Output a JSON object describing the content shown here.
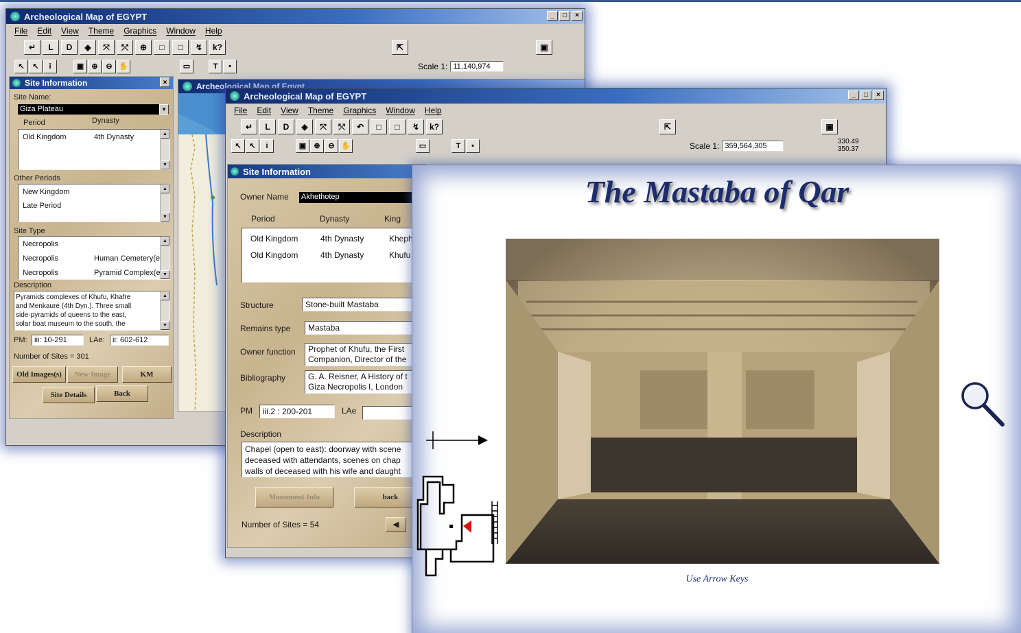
{
  "screen": {
    "accent": "#3a6ec0",
    "panel_color": "#d2c09c"
  },
  "back_window": {
    "title": "Archeological Map of EGYPT",
    "controls": [
      "_",
      "□",
      "×"
    ],
    "menu": [
      "File",
      "Edit",
      "View",
      "Theme",
      "Graphics",
      "Window",
      "Help"
    ],
    "tools_row1": [
      "↵",
      "L",
      "D",
      "◈",
      "⤧",
      "⤲",
      "⊕",
      "□",
      "□",
      "↯",
      "k?"
    ],
    "tools_row2": [
      "↖",
      "↖",
      "i",
      "▣",
      "⊕",
      "⊖",
      "✋",
      "▭",
      "T",
      "•"
    ],
    "scale_label": "Scale 1:",
    "scale_value": "11,140,974",
    "inner_title": "Archeological Map of Egypt",
    "site_info": {
      "title": "Site Information",
      "site_name_label": "Site Name:",
      "site_name_value": "Giza Plateau",
      "col_period": "Period",
      "col_dynasty": "Dynasty",
      "period_row": {
        "period": "Old Kingdom",
        "dynasty": "4th Dynasty"
      },
      "other_periods_label": "Other Periods",
      "other_periods": [
        "New Kingdom",
        "Late Period"
      ],
      "site_type_label": "Site Type",
      "site_types": [
        {
          "type": "Necropolis",
          "detail": ""
        },
        {
          "type": "Necropolis",
          "detail": "Human Cemetery(e"
        },
        {
          "type": "Necropolis",
          "detail": "Pyramid Complex(e"
        }
      ],
      "description_label": "Description",
      "description": [
        "Pyramids complexes of Khufu, Khafre",
        "and Menkaure (4th Dyn.). Three small",
        "side-pyramids of queens to the east,",
        "solar boat museum to the south, the"
      ],
      "pm_label": "PM:",
      "pm_value": "iii: 10-291",
      "lae_label": "LAe:",
      "lae_value": "ii: 602-612",
      "count": "Number of Sites = 301",
      "buttons": {
        "old_images": "Old Images(s)",
        "new_image": "New Image",
        "km": "KM",
        "site_details": "Site Details",
        "back": "Back"
      }
    }
  },
  "mid_window": {
    "title": "Archeological Map of EGYPT",
    "controls": [
      "_",
      "□",
      "×"
    ],
    "menu": [
      "File",
      "Edit",
      "View",
      "Theme",
      "Graphics",
      "Window",
      "Help"
    ],
    "tools_row1": [
      "↵",
      "L",
      "D",
      "◈",
      "⤧",
      "⤲",
      "↶",
      "□",
      "□",
      "↯",
      "k?"
    ],
    "tools_row2": [
      "↖",
      "↖",
      "i",
      "▣",
      "⊕",
      "⊖",
      "✋",
      "▭",
      "T",
      "•"
    ],
    "scale_label": "Scale 1:",
    "scale_value": "359,564,305",
    "coords": [
      "330.49",
      "350.37"
    ],
    "site_info": {
      "title": "Site Information",
      "owner_name_label": "Owner Name",
      "owner_name_value": "Akhethotep",
      "col_period": "Period",
      "col_dynasty": "Dynasty",
      "col_king": "King",
      "rows": [
        {
          "period": "Old Kingdom",
          "dynasty": "4th Dynasty",
          "king": "Kheph"
        },
        {
          "period": "Old Kingdom",
          "dynasty": "4th Dynasty",
          "king": "Khufu"
        }
      ],
      "structure_label": "Structure",
      "structure_value": "Stone-built Mastaba",
      "remains_label": "Remains type",
      "remains_value": "Mastaba",
      "owner_function_label": "Owner function",
      "owner_function_value": [
        "Prophet of Khufu, the First",
        "Companion, Director of the"
      ],
      "bibliography_label": "Bibliography",
      "bibliography_value": [
        "G. A. Reisner, A History of t",
        "Giza Necropolis I, London"
      ],
      "pm_label": "PM",
      "pm_value": "iii.2 : 200-201",
      "lae_label": "LAe",
      "lae_value": "",
      "description_label": "Description",
      "description": [
        "Chapel (open to east): doorway with scene",
        "deceased with attendants, scenes on chap",
        "walls of deceased with his wife and daught"
      ],
      "buttons": {
        "monument_info": "Monument Info",
        "back": "back"
      },
      "count": "Number of Sites = 54"
    }
  },
  "viewer": {
    "title": "The Mastaba of Qar",
    "caption": "Use Arrow Keys"
  }
}
